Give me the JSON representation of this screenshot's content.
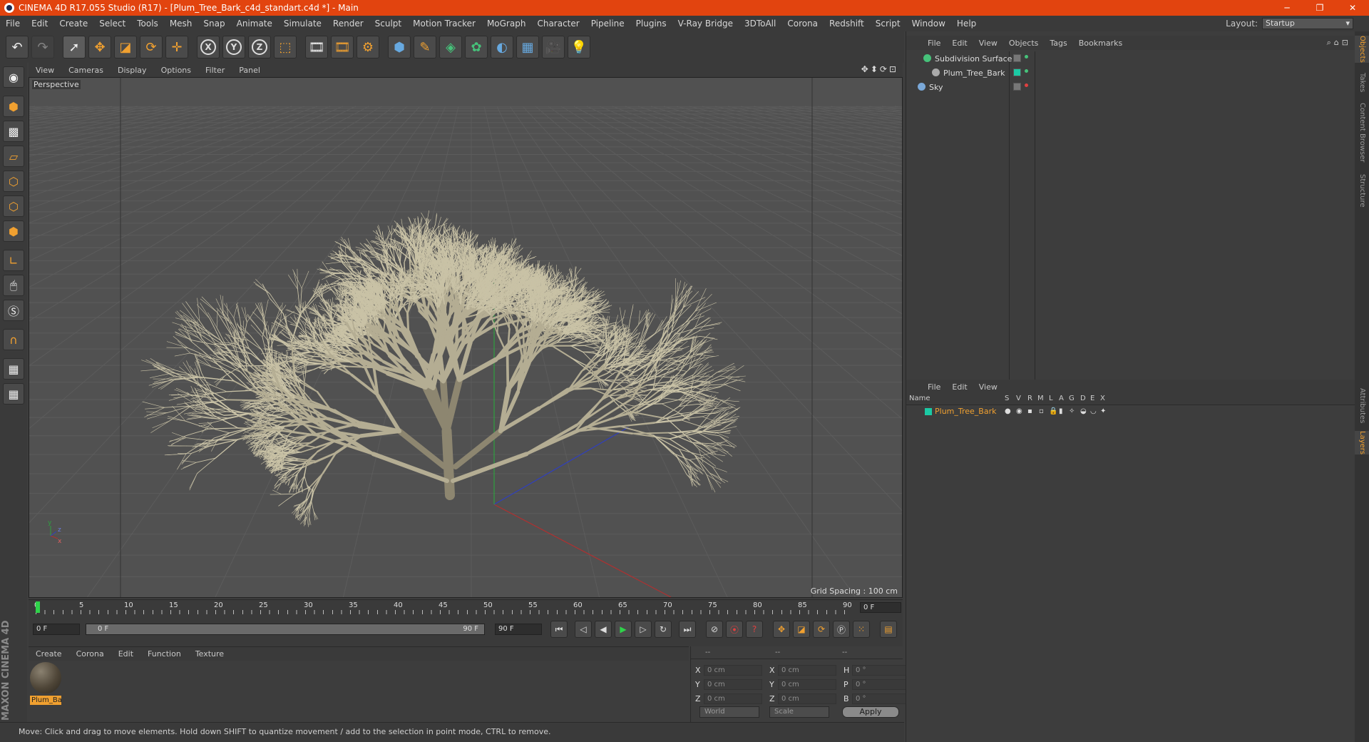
{
  "window": {
    "title": "CINEMA 4D R17.055 Studio (R17) - [Plum_Tree_Bark_c4d_standart.c4d *] - Main",
    "controls": [
      "─",
      "❐",
      "✕"
    ]
  },
  "menubar": {
    "items": [
      "File",
      "Edit",
      "Create",
      "Select",
      "Tools",
      "Mesh",
      "Snap",
      "Animate",
      "Simulate",
      "Render",
      "Sculpt",
      "Motion Tracker",
      "MoGraph",
      "Character",
      "Pipeline",
      "Plugins",
      "V-Ray Bridge",
      "3DToAll",
      "Corona",
      "Redshift",
      "Script",
      "Window",
      "Help"
    ],
    "layout_label": "Layout:",
    "layout_value": "Startup"
  },
  "toolbar": {
    "icons": [
      "undo-icon",
      "redo-icon",
      "live-selection-icon",
      "move-icon",
      "scale-icon",
      "rotate-icon",
      "recent-tools-icon",
      "x-axis-icon",
      "y-axis-icon",
      "z-axis-icon",
      "coordinate-system-icon",
      "render-view-icon",
      "render-picture-viewer-icon",
      "edit-render-settings-icon",
      "cube-icon",
      "pen-icon",
      "subdivision-icon",
      "cloner-icon",
      "deformer-icon",
      "floor-icon",
      "camera-icon",
      "light-icon"
    ],
    "axis_x": "X",
    "axis_y": "Y",
    "axis_z": "Z"
  },
  "viewport": {
    "menu": [
      "View",
      "Cameras",
      "Display",
      "Options",
      "Filter",
      "Panel"
    ],
    "label": "Perspective",
    "grid_spacing": "Grid Spacing : 100 cm",
    "axis_y": "y",
    "axis_z": "z",
    "axis_x": "x",
    "colors": {
      "background": "#515151",
      "grid": "#5c5c5c",
      "tree": "#b4ad93"
    }
  },
  "timeline": {
    "ticks": [
      "0",
      "5",
      "10",
      "15",
      "20",
      "25",
      "30",
      "35",
      "40",
      "45",
      "50",
      "55",
      "60",
      "65",
      "70",
      "75",
      "80",
      "85",
      "90"
    ],
    "current_frame": "0 F"
  },
  "playback": {
    "start": "0 F",
    "slider_left": "0 F",
    "slider_right": "90 F",
    "end": "90 F"
  },
  "materials": {
    "menu": [
      "Create",
      "Corona",
      "Edit",
      "Function",
      "Texture"
    ],
    "item_label": "Plum_Ba"
  },
  "coordinates": {
    "header": [
      "--",
      "--",
      "--"
    ],
    "rows": [
      {
        "l1": "X",
        "v1": "0 cm",
        "l2": "X",
        "v2": "0 cm",
        "l3": "H",
        "v3": "0 °"
      },
      {
        "l1": "Y",
        "v1": "0 cm",
        "l2": "Y",
        "v2": "0 cm",
        "l3": "P",
        "v3": "0 °"
      },
      {
        "l1": "Z",
        "v1": "0 cm",
        "l2": "Z",
        "v2": "0 cm",
        "l3": "B",
        "v3": "0 °"
      }
    ],
    "space": "World",
    "mode": "Scale",
    "apply": "Apply"
  },
  "status": "Move: Click and drag to move elements. Hold down SHIFT to quantize movement / add to the selection in point mode, CTRL to remove.",
  "logo": "MAXON CINEMA 4D",
  "objects_panel": {
    "menu": [
      "File",
      "Edit",
      "View",
      "Objects",
      "Tags",
      "Bookmarks"
    ],
    "items": [
      {
        "name": "Subdivision Surface",
        "color": "#46c27a"
      },
      {
        "name": "Plum_Tree_Bark",
        "color": "#aaaaaa"
      },
      {
        "name": "Sky",
        "color": "#7aa8d8"
      }
    ]
  },
  "layers_panel": {
    "menu": [
      "File",
      "Edit",
      "View"
    ],
    "columns": [
      "Name",
      "S",
      "V",
      "R",
      "M",
      "L",
      "A",
      "G",
      "D",
      "E",
      "X"
    ],
    "layer_name": "Plum_Tree_Bark",
    "layer_color": "#1bcaa4"
  },
  "side_tabs": [
    "Objects",
    "Takes",
    "Content Browser",
    "Structure",
    "Attributes",
    "Layers"
  ]
}
